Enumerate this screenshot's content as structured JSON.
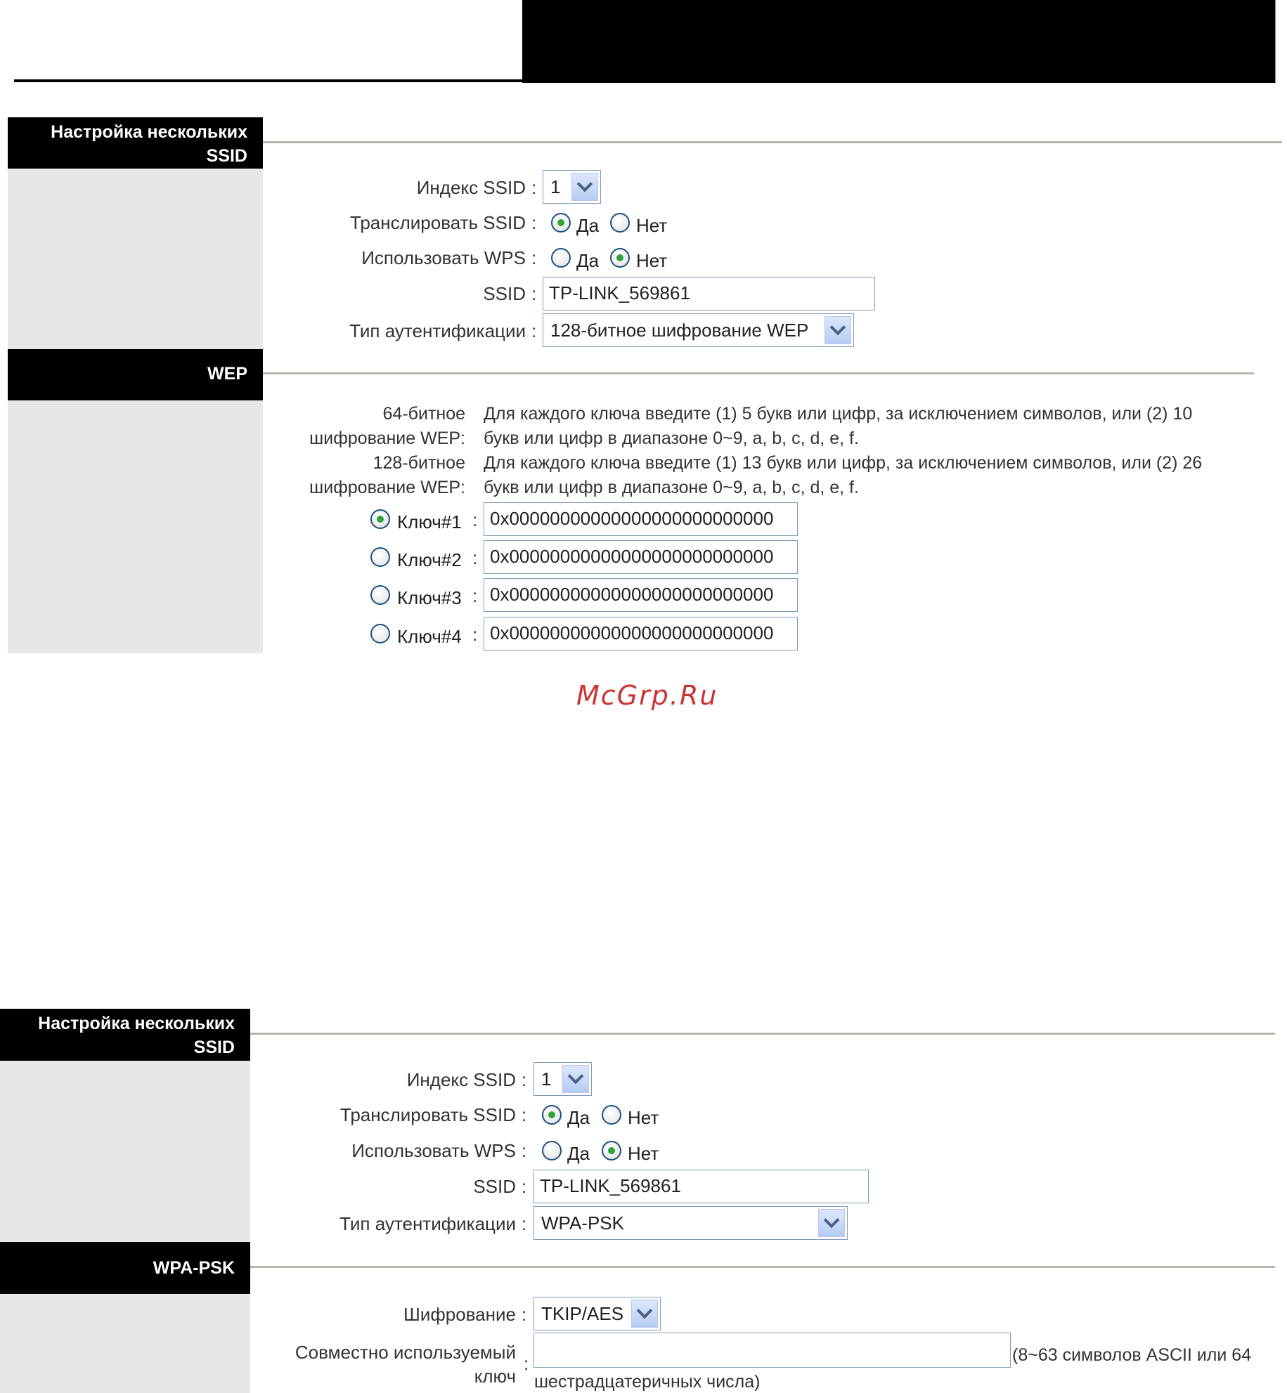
{
  "watermark": "McGrp.Ru",
  "panel1": {
    "header_line1": "Настройка нескольких",
    "header_line2": "SSID",
    "ssid_index_label": "Индекс SSID",
    "ssid_index_value": "1",
    "broadcast_label": "Транслировать SSID",
    "broadcast_yes": "Да",
    "broadcast_no": "Нет",
    "wps_label": "Использовать WPS",
    "wps_yes": "Да",
    "wps_no": "Нет",
    "ssid_label": "SSID",
    "ssid_value": "TP-LINK_569861",
    "auth_label": "Тип аутентификации",
    "auth_value": "128-битное шифрование WEP",
    "wep_header": "WEP",
    "wep64_label_1": "64-битное",
    "wep64_label_2": "шифрование WEP:",
    "wep64_text_1": "Для каждого ключа введите (1) 5 букв или цифр, за исключением символов, или (2) 10",
    "wep64_text_2": "букв или цифр в диапазоне 0~9, a, b, c, d, e, f.",
    "wep128_label_1": "128-битное",
    "wep128_label_2": "шифрование WEP:",
    "wep128_text_1": "Для каждого ключа введите (1) 13 букв или цифр, за исключением символов, или (2) 26",
    "wep128_text_2": "букв или цифр в диапазоне 0~9, a, b, c, d, e, f.",
    "keys": [
      {
        "label": "Ключ#1",
        "value": "0x00000000000000000000000000"
      },
      {
        "label": "Ключ#2",
        "value": "0x00000000000000000000000000"
      },
      {
        "label": "Ключ#3",
        "value": "0x00000000000000000000000000"
      },
      {
        "label": "Ключ#4",
        "value": "0x00000000000000000000000000"
      }
    ]
  },
  "panel2": {
    "header_line1": "Настройка нескольких",
    "header_line2": "SSID",
    "ssid_index_label": "Индекс SSID",
    "ssid_index_value": "1",
    "broadcast_label": "Транслировать SSID",
    "broadcast_yes": "Да",
    "broadcast_no": "Нет",
    "wps_label": "Использовать WPS",
    "wps_yes": "Да",
    "wps_no": "Нет",
    "ssid_label": "SSID",
    "ssid_value": "TP-LINK_569861",
    "auth_label": "Тип аутентификации",
    "auth_value": "WPA-PSK",
    "wpa_header": "WPA-PSK",
    "encryption_label": "Шифрование",
    "encryption_value": "TKIP/AES",
    "psk_label_1": "Совместно используемый",
    "psk_label_2": "ключ",
    "psk_value": "",
    "psk_hint_1": "(8~63 символов ASCII или 64",
    "psk_hint_2": "шестрадцатеричных числа)"
  },
  "colon": ":"
}
